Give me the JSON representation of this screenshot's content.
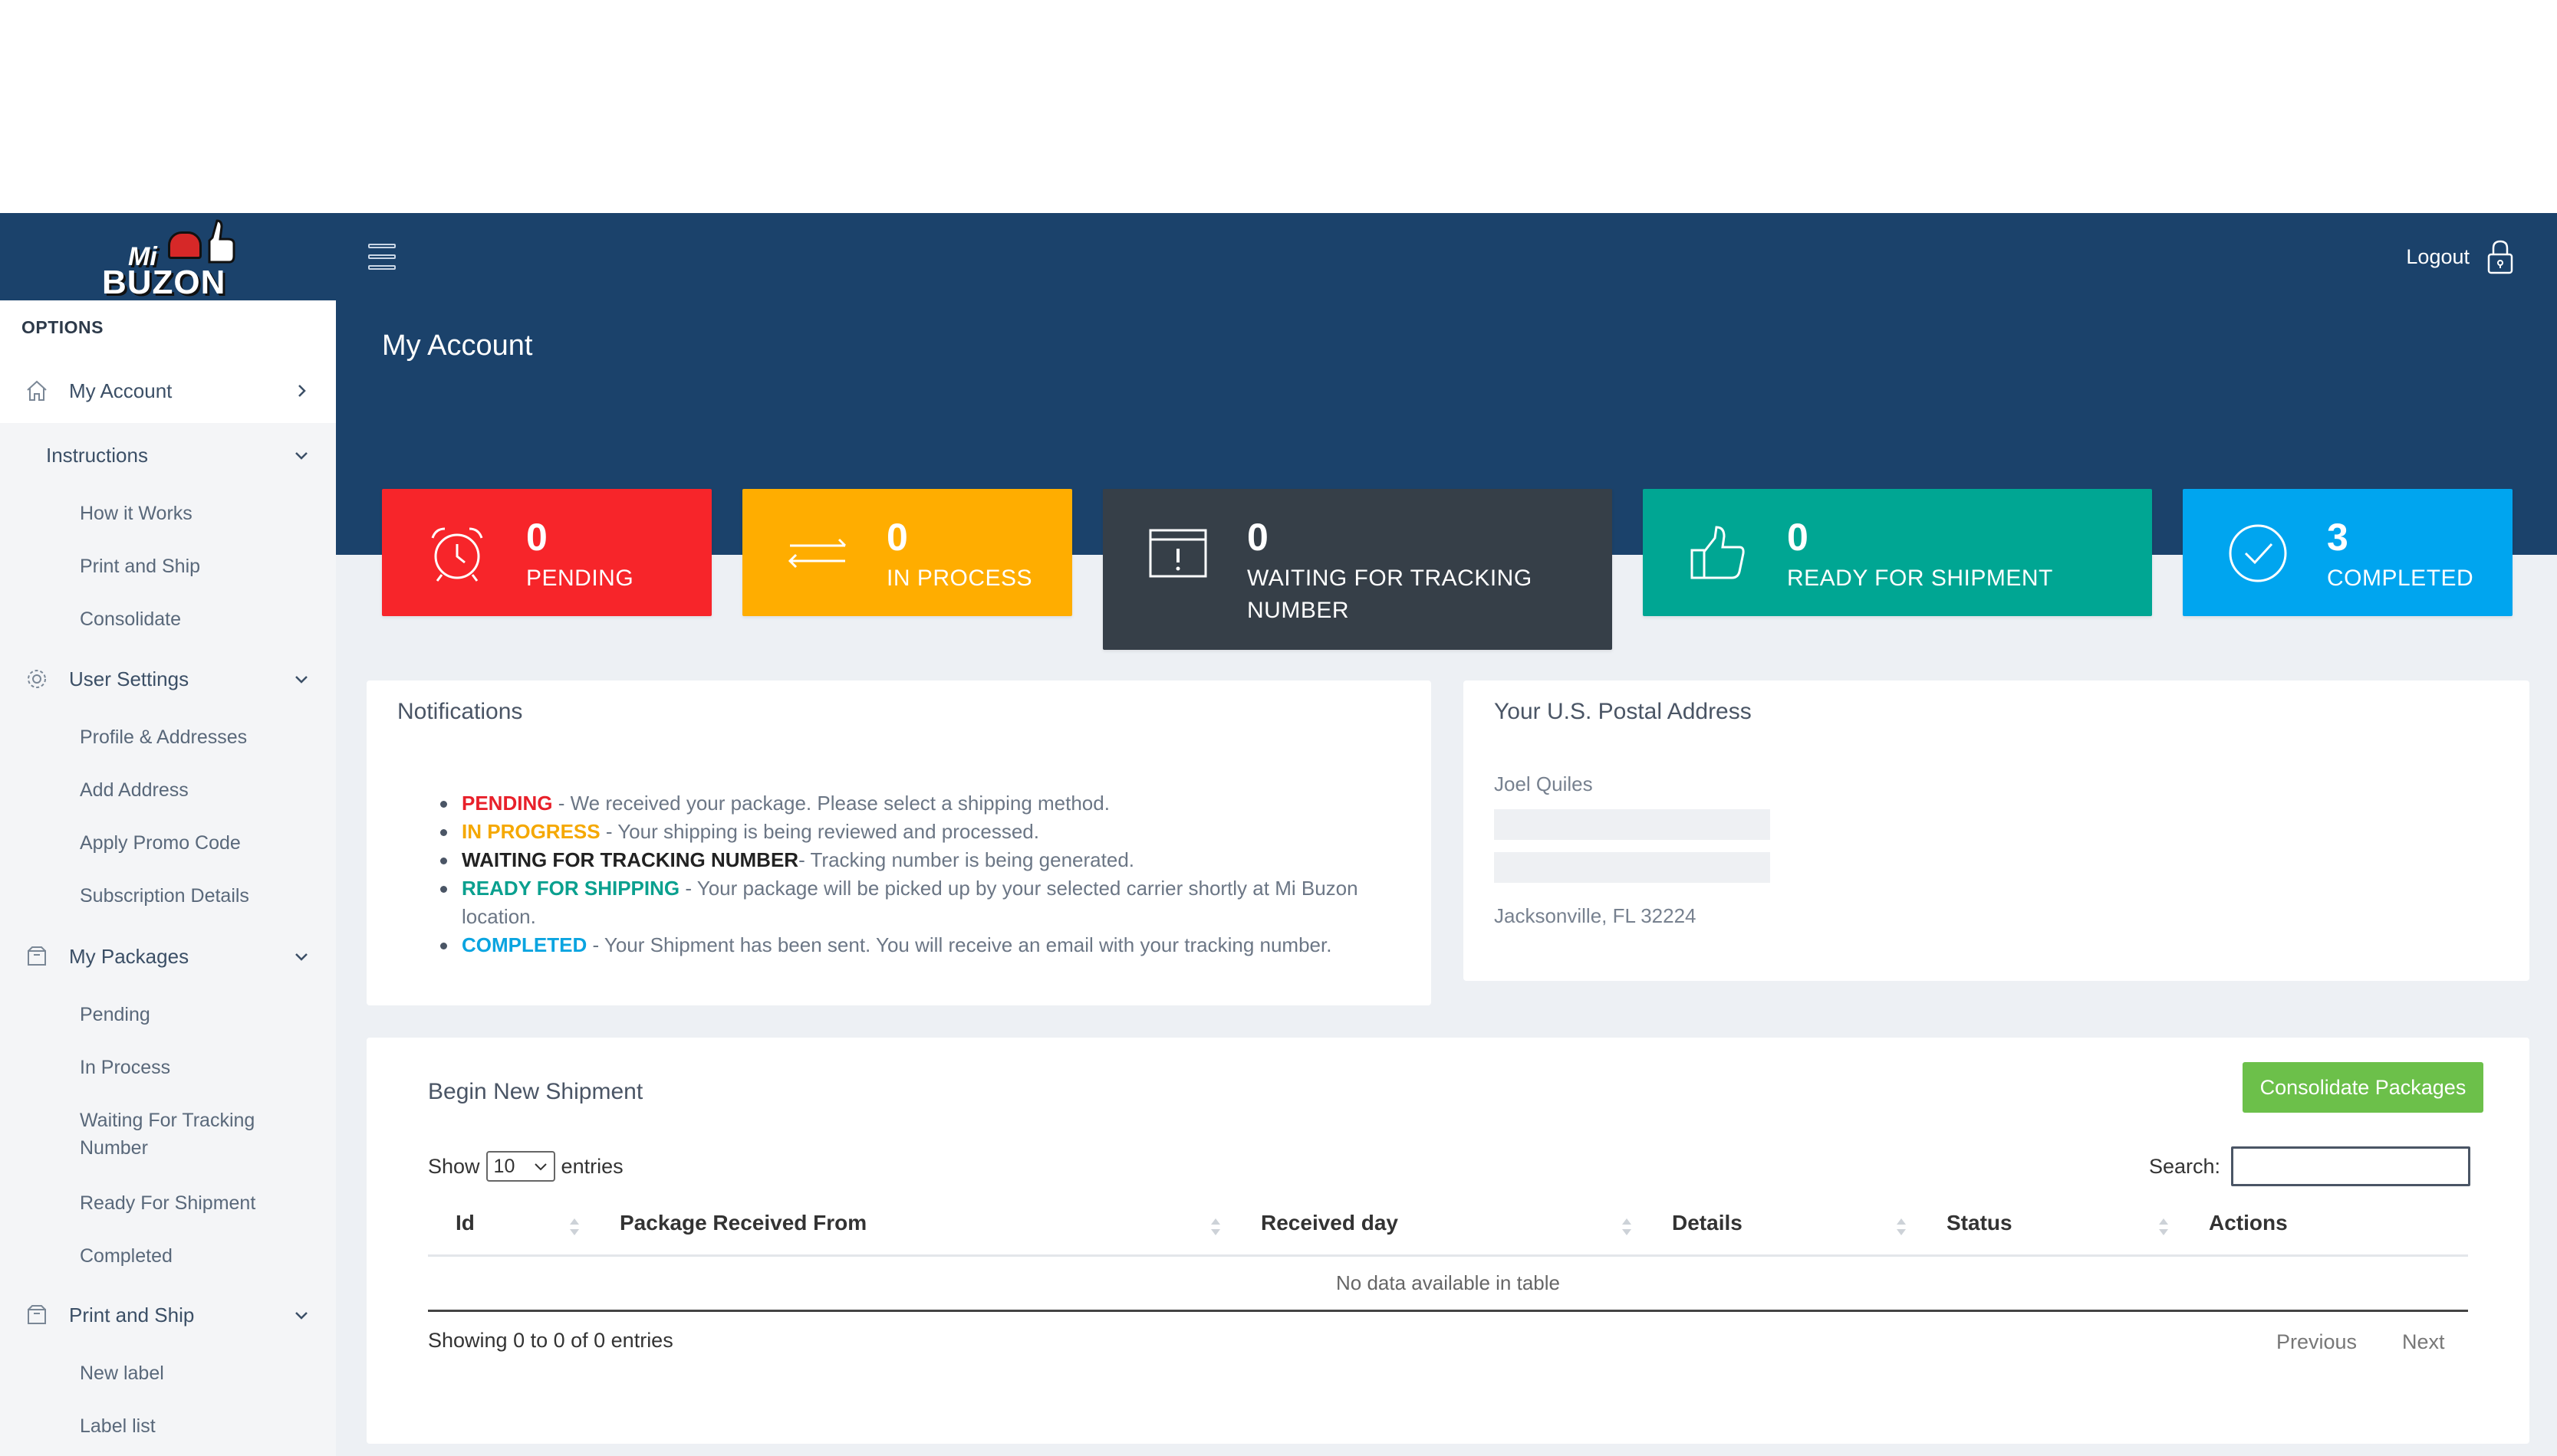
{
  "brand": {
    "logo_line1": "Mi",
    "logo_line2": "BUZON"
  },
  "header": {
    "logout_label": "Logout",
    "page_title": "My Account"
  },
  "sidebar": {
    "options_label": "OPTIONS",
    "my_account": "My Account",
    "instructions": {
      "label": "Instructions",
      "items": [
        "How it Works",
        "Print and Ship",
        "Consolidate"
      ]
    },
    "user_settings": {
      "label": "User Settings",
      "items": [
        "Profile & Addresses",
        "Add Address",
        "Apply Promo Code",
        "Subscription Details"
      ]
    },
    "my_packages": {
      "label": "My Packages",
      "items": [
        "Pending",
        "In Process",
        "Waiting For Tracking",
        "Number",
        "Ready For Shipment",
        "Completed"
      ]
    },
    "print_and_ship": {
      "label": "Print and Ship",
      "items": [
        "New label",
        "Label list"
      ]
    }
  },
  "cards": [
    {
      "count": "0",
      "label": "PENDING",
      "color": "#f7252a"
    },
    {
      "count": "0",
      "label": "IN PROCESS",
      "color": "#ffad00"
    },
    {
      "count": "0",
      "label": "WAITING FOR TRACKING",
      "label2": "NUMBER",
      "color": "#363f48"
    },
    {
      "count": "0",
      "label": "READY FOR SHIPMENT",
      "color": "#00a693"
    },
    {
      "count": "3",
      "label": "COMPLETED",
      "color": "#00a5ef"
    }
  ],
  "notifications": {
    "title": "Notifications",
    "items": [
      {
        "key": "PENDING",
        "text": " - We received your package. Please select a shipping method."
      },
      {
        "key": "IN PROGRESS",
        "text": " - Your shipping is being reviewed and processed."
      },
      {
        "key": "WAITING FOR TRACKING NUMBER",
        "text": "- Tracking number is being generated."
      },
      {
        "key": "READY FOR SHIPPING",
        "text": " - Your package will be picked up by your selected carrier shortly at Mi Buzon location."
      },
      {
        "key": "COMPLETED",
        "text": " - Your Shipment has been sent. You will receive an email with your tracking number."
      }
    ]
  },
  "postal": {
    "title": "Your U.S. Postal Address",
    "name": "Joel Quiles",
    "city": "Jacksonville, FL 32224"
  },
  "shipment": {
    "title": "Begin New Shipment",
    "consolidate_button": "Consolidate Packages",
    "show_label": "Show",
    "show_value": "10",
    "entries_label": "entries",
    "search_label": "Search:",
    "columns": [
      "Id",
      "Package Received From",
      "Received day",
      "Details",
      "Status",
      "Actions"
    ],
    "empty_text": "No data available in table",
    "showing_text": "Showing 0 to 0 of 0 entries",
    "previous": "Previous",
    "next": "Next"
  }
}
